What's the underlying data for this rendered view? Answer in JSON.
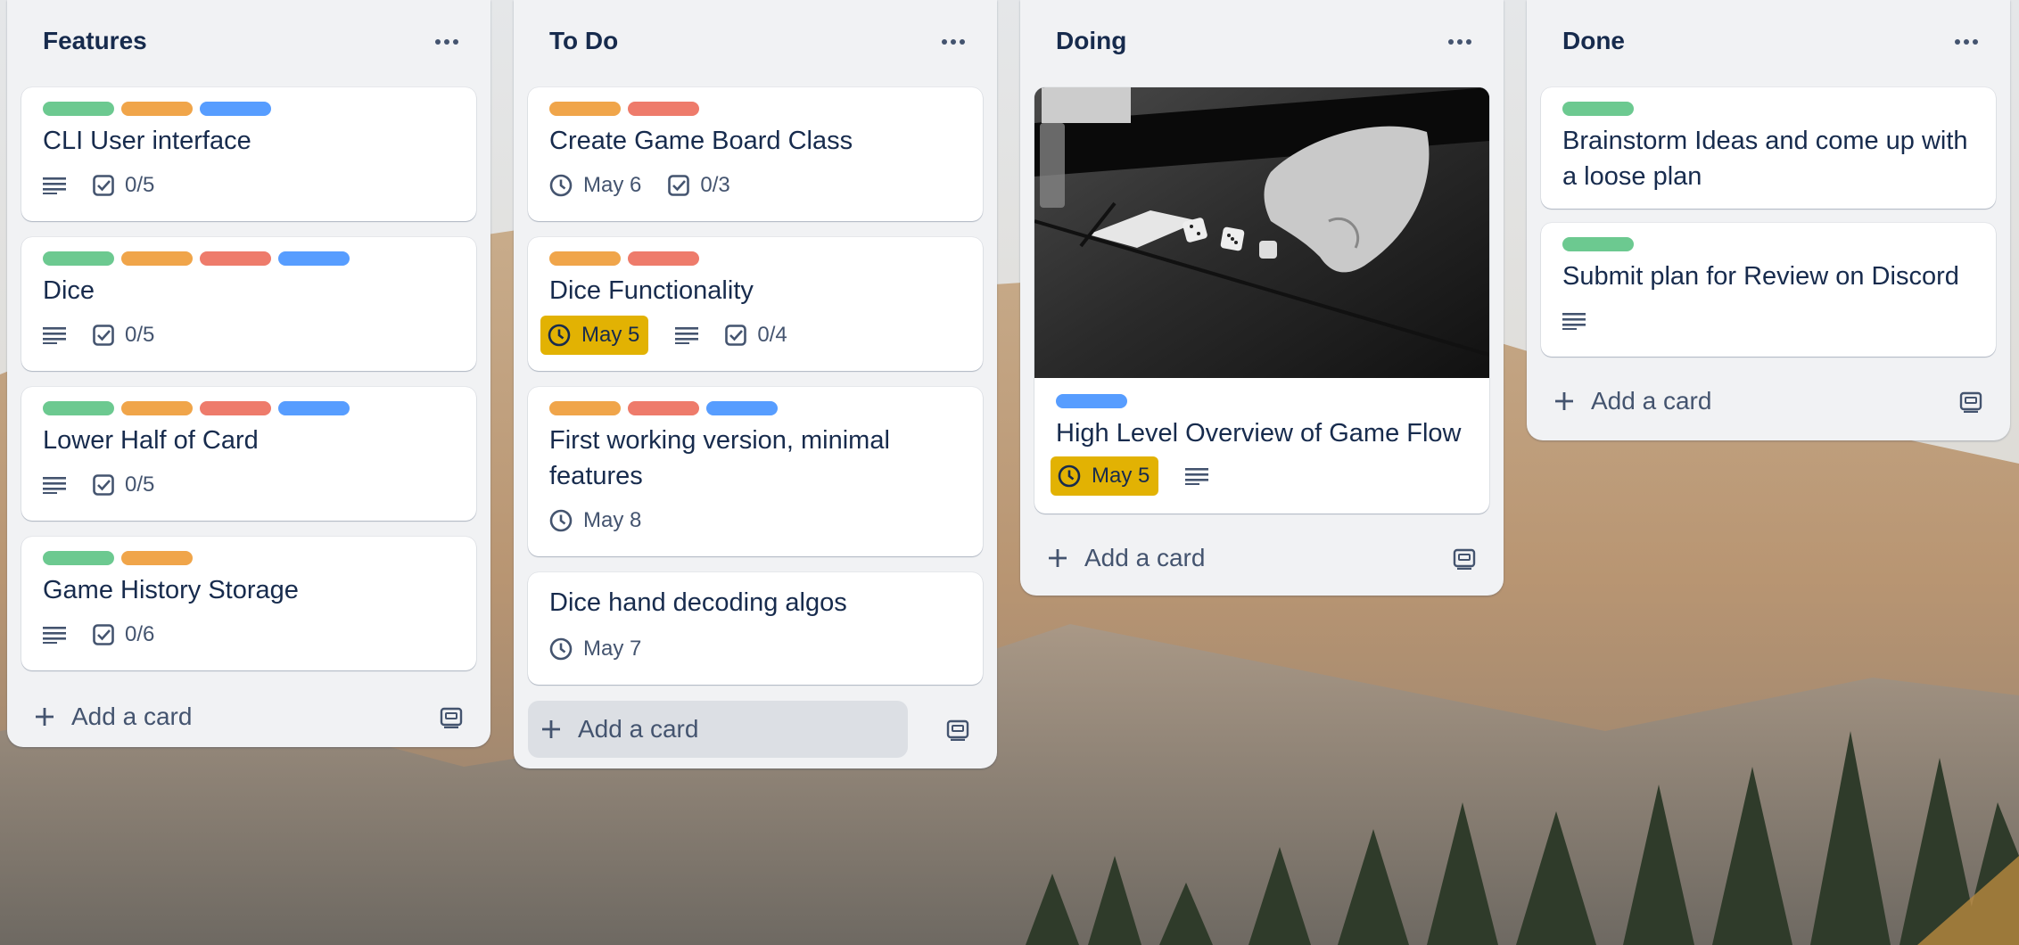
{
  "board": {
    "lists": [
      {
        "title": "Features",
        "cards": [
          {
            "title": "CLI User interface",
            "labels": [
              "green",
              "orange",
              "blue"
            ],
            "checklist": "0/5"
          },
          {
            "title": "Dice",
            "labels": [
              "green",
              "orange",
              "red",
              "blue"
            ],
            "checklist": "0/5"
          },
          {
            "title": "Lower Half of Card",
            "labels": [
              "green",
              "orange",
              "red",
              "blue"
            ],
            "checklist": "0/5"
          },
          {
            "title": "Game History Storage",
            "labels": [
              "green",
              "orange"
            ],
            "checklist": "0/6"
          }
        ],
        "add_label": "Add a card"
      },
      {
        "title": "To Do",
        "cards": [
          {
            "title": "Create Game Board Class",
            "labels": [
              "orange",
              "red"
            ],
            "date": "May 6",
            "checklist": "0/3"
          },
          {
            "title": "Dice Functionality",
            "labels": [
              "orange",
              "red"
            ],
            "date": "May 5",
            "date_status": "due-soon",
            "checklist": "0/4"
          },
          {
            "title": "First working version, minimal features",
            "labels": [
              "orange",
              "red",
              "blue"
            ],
            "date": "May 8"
          },
          {
            "title": "Dice hand decoding algos",
            "labels": [],
            "date": "May 7"
          }
        ],
        "add_label": "Add a card"
      },
      {
        "title": "Doing",
        "cards": [
          {
            "title": "High Level Overview of Game Flow",
            "labels": [
              "blue"
            ],
            "date": "May 5",
            "date_status": "due-soon",
            "cover": "black-and-white photo of a hand rolling dice on a table"
          }
        ],
        "add_label": "Add a card"
      },
      {
        "title": "Done",
        "cards": [
          {
            "title": "Brainstorm Ideas and come up with a loose plan",
            "labels": [
              "green"
            ]
          },
          {
            "title": "Submit plan for Review on Discord",
            "labels": [
              "green"
            ]
          }
        ],
        "add_label": "Add a card"
      }
    ]
  },
  "colors": {
    "green": "#6cc990",
    "orange": "#f0a54a",
    "red": "#ee7b6b",
    "blue": "#579dff",
    "due_soon": "#e2b203",
    "list_bg": "#f1f2f4"
  }
}
